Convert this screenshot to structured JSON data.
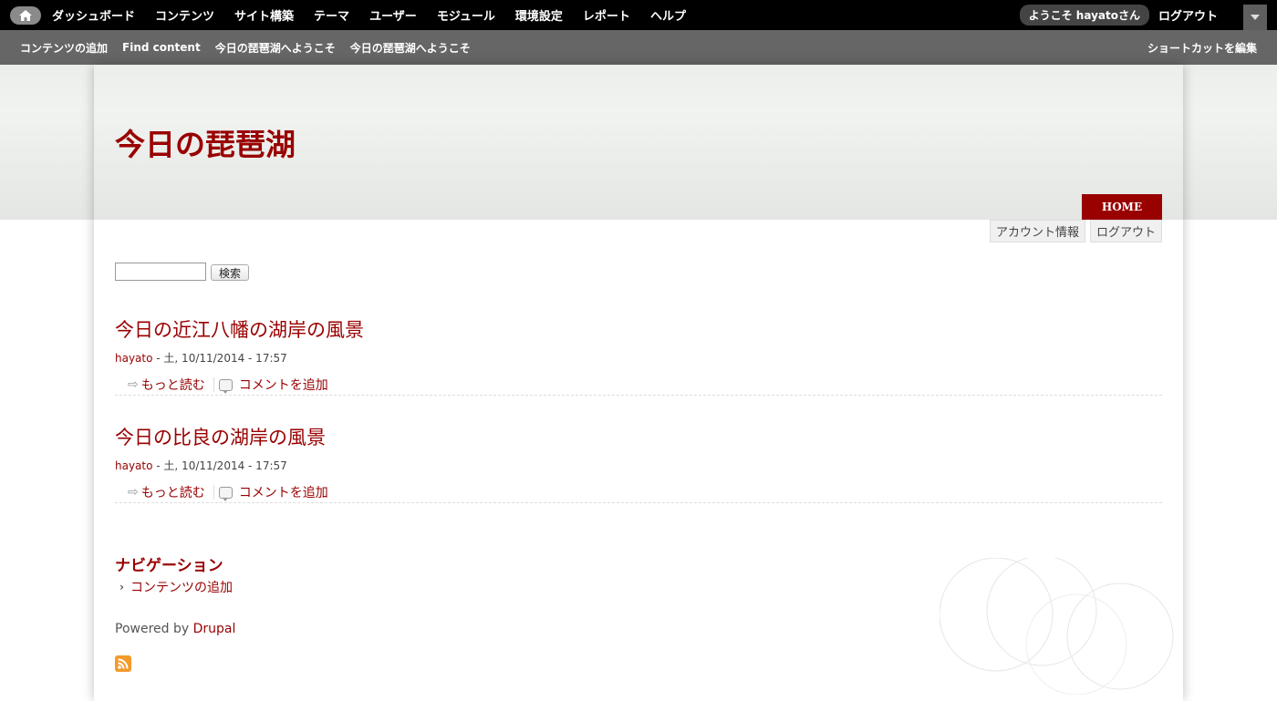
{
  "toolbar": {
    "menu": [
      "ダッシュボード",
      "コンテンツ",
      "サイト構築",
      "テーマ",
      "ユーザー",
      "モジュール",
      "環境設定",
      "レポート",
      "ヘルプ"
    ],
    "welcome": "ようこそ hayatoさん",
    "logout": "ログアウト"
  },
  "shortcuts": {
    "items": [
      "コンテンツの追加",
      "Find content",
      "今日の琵琶湖へようこそ",
      "今日の琵琶湖へようこそ"
    ],
    "edit": "ショートカットを編集"
  },
  "site": {
    "name": "今日の琵琶湖",
    "home_tab": "HOME",
    "account": "アカウント情報",
    "logout": "ログアウト"
  },
  "search": {
    "value": "",
    "button": "検索"
  },
  "nodes": [
    {
      "title": "今日の近江八幡の湖岸の風景",
      "author": "hayato",
      "date": " - 土, 10/11/2014 - 17:57",
      "read_more": "もっと読む",
      "add_comment": "コメントを追加"
    },
    {
      "title": "今日の比良の湖岸の風景",
      "author": "hayato",
      "date": " - 土, 10/11/2014 - 17:57",
      "read_more": "もっと読む",
      "add_comment": "コメントを追加"
    }
  ],
  "navigation": {
    "heading": "ナビゲーション",
    "items": [
      "コンテンツの追加"
    ]
  },
  "footer": {
    "powered_by": "Powered by ",
    "drupal": "Drupal"
  },
  "colors": {
    "accent": "#990000",
    "toolbar_bg": "#000000",
    "shortcut_bg": "#666666"
  }
}
